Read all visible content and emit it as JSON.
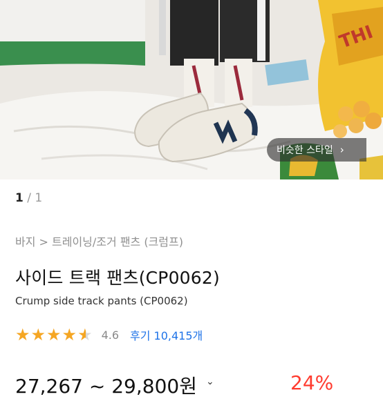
{
  "hero": {
    "similar_style_label": "비슷한 스타일"
  },
  "pager": {
    "current": "1",
    "separator": " / ",
    "total": "1"
  },
  "breadcrumb": {
    "text": "바지 > 트레이닝/조거 팬츠 (크럼프)"
  },
  "product": {
    "title": "사이드 트랙 팬츠(CP0062)",
    "subtitle": "Crump side track pants (CP0062)"
  },
  "rating": {
    "stars": 4.6,
    "score_text": "4.6",
    "reviews_text": "후기 10,415개"
  },
  "price": {
    "range_text": "27,267 ~ 29,800원",
    "discount_text": "24%"
  },
  "colors": {
    "star": "#f5a623",
    "link": "#1e73e8",
    "discount": "#ff3b2f"
  }
}
